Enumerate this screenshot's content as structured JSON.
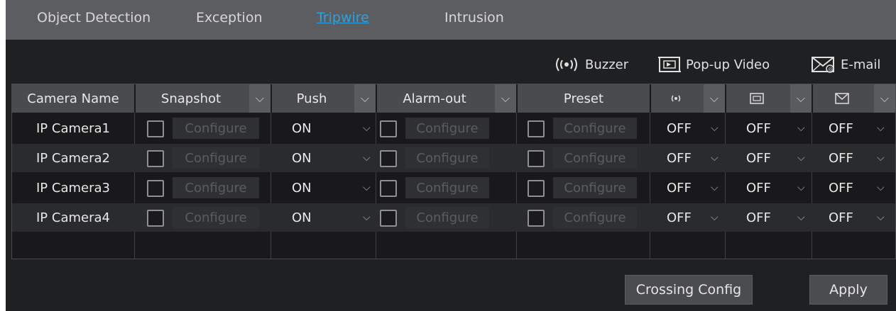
{
  "tabs": [
    {
      "label": "Object Detection",
      "active": false
    },
    {
      "label": "Exception",
      "active": false
    },
    {
      "label": "Tripwire",
      "active": true
    },
    {
      "label": "Intrusion",
      "active": false
    }
  ],
  "alarm_header": {
    "buzzer_label": "Buzzer",
    "popup_label": "Pop-up Video",
    "email_label": "E-mail"
  },
  "table": {
    "headers": {
      "camera_name": "Camera Name",
      "snapshot": "Snapshot",
      "push": "Push",
      "alarm_out": "Alarm-out",
      "preset": "Preset"
    },
    "rows": [
      {
        "camera": "IP Camera1",
        "snapshot_btn": "Configure",
        "push": "ON",
        "alarm_btn": "Configure",
        "preset_btn": "Configure",
        "buzzer": "OFF",
        "popup": "OFF",
        "email": "OFF"
      },
      {
        "camera": "IP Camera2",
        "snapshot_btn": "Configure",
        "push": "ON",
        "alarm_btn": "Configure",
        "preset_btn": "Configure",
        "buzzer": "OFF",
        "popup": "OFF",
        "email": "OFF"
      },
      {
        "camera": "IP Camera3",
        "snapshot_btn": "Configure",
        "push": "ON",
        "alarm_btn": "Configure",
        "preset_btn": "Configure",
        "buzzer": "OFF",
        "popup": "OFF",
        "email": "OFF"
      },
      {
        "camera": "IP Camera4",
        "snapshot_btn": "Configure",
        "push": "ON",
        "alarm_btn": "Configure",
        "preset_btn": "Configure",
        "buzzer": "OFF",
        "popup": "OFF",
        "email": "OFF"
      }
    ]
  },
  "buttons": {
    "crossing_config": "Crossing Config",
    "apply": "Apply"
  },
  "colors": {
    "active_tab": "#2aa3e0",
    "background": "#1f2022",
    "header_cell": "#4a4b4e"
  }
}
